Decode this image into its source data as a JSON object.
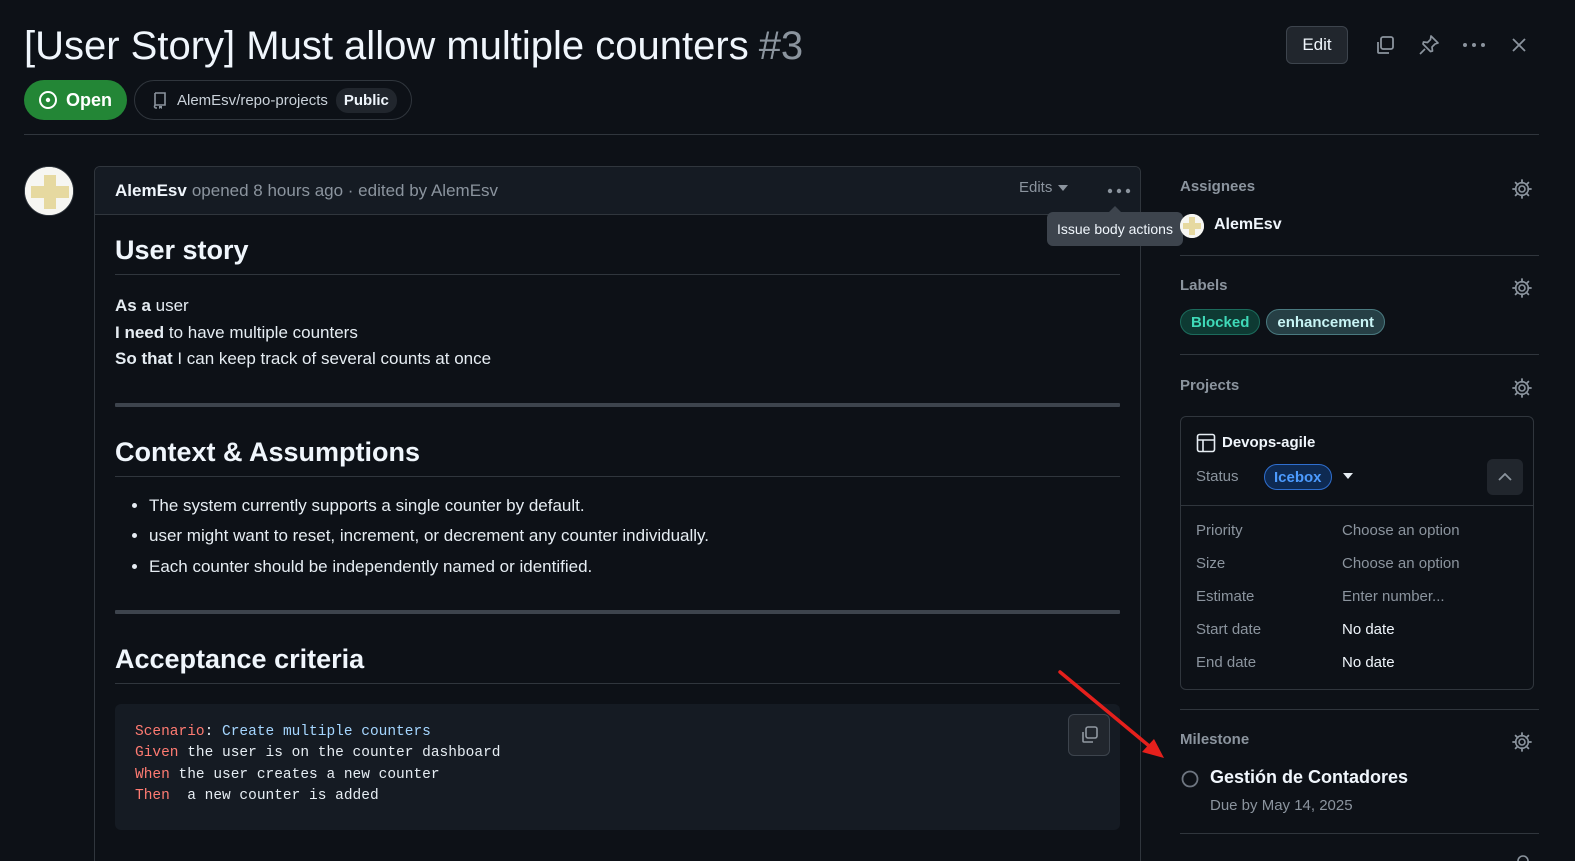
{
  "issue": {
    "title": "[User Story] Must allow multiple counters",
    "number": "#3",
    "state": "Open",
    "repo": "AlemEsv/repo-projects",
    "visibility": "Public",
    "edit_label": "Edit"
  },
  "comment": {
    "author": "AlemEsv",
    "meta": "opened 8 hours ago · edited by AlemEsv",
    "edits_label": "Edits",
    "tooltip": "Issue body actions",
    "h_user_story": "User story",
    "as_a_label": "As a",
    "as_a_text": " user",
    "i_need_label": "I need",
    "i_need_text": " to have multiple counters",
    "so_that_label": "So that",
    "so_that_text": " I can keep track of several counts at once",
    "h_context": "Context & Assumptions",
    "bullets": [
      "The system currently supports a single counter by default.",
      "user might want to reset, increment, or decrement any counter individually.",
      "Each counter should be independently named or identified."
    ],
    "h_acceptance": "Acceptance criteria",
    "code": {
      "l1_kw": "Scenario",
      "l1_colon": ":",
      "l1_rest": " Create multiple counters",
      "l2_kw": "Given",
      "l2_rest": " the user is on the counter dashboard",
      "l3_kw": "When",
      "l3_rest": " the user creates a new counter",
      "l4_kw": "Then",
      "l4_rest": "  a new counter is added"
    }
  },
  "sidebar": {
    "assignees_title": "Assignees",
    "assignee": "AlemEsv",
    "labels_title": "Labels",
    "labels": [
      {
        "name": "Blocked",
        "color": "#3fb9a0"
      },
      {
        "name": "enhancement",
        "color": "#a2eeef"
      }
    ],
    "projects_title": "Projects",
    "project_name": "Devops-agile",
    "status_label": "Status",
    "status_value": "Icebox",
    "fields": [
      {
        "label": "Priority",
        "value": "Choose an option"
      },
      {
        "label": "Size",
        "value": "Choose an option"
      },
      {
        "label": "Estimate",
        "value": "Enter number..."
      },
      {
        "label": "Start date",
        "value": "No date"
      },
      {
        "label": "End date",
        "value": "No date"
      }
    ],
    "milestone_title": "Milestone",
    "milestone_name": "Gestión de Contadores",
    "milestone_due": "Due by May 14, 2025"
  },
  "colors": {
    "open": "#238636",
    "annotation_arrow": "#e5201c",
    "icebox": "#2f81f7"
  }
}
